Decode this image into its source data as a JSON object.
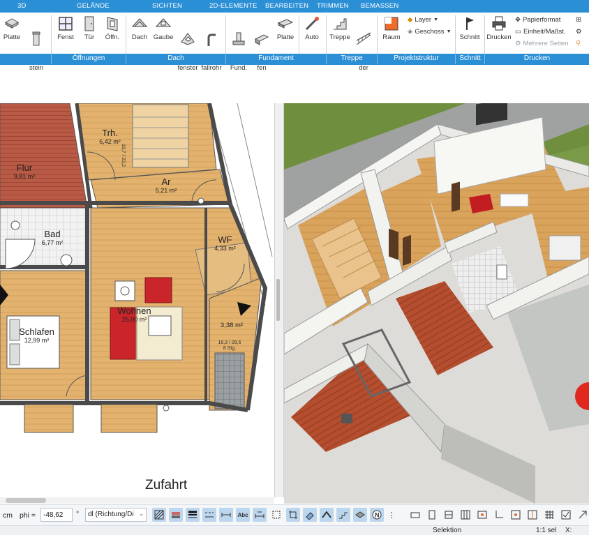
{
  "tabs": [
    "3D",
    "GELÄNDE",
    "SICHTEN",
    "2D-ELEMENTE",
    "BEARBEITEN",
    "TRIMMEN",
    "BEMASSEN"
  ],
  "ribbon": {
    "platte1": "Platte",
    "schornstein": "Schorn-\nstein",
    "fenst": "Fenst",
    "tuer": "Tür",
    "oeffn": "Öffn.",
    "dach": "Dach",
    "gaube": "Gaube",
    "dachfenster": "Dach-\nfenster",
    "regenfallrohr": "Regen-\nfallrohr",
    "einzelfund": "Einzel\nFund.",
    "streifen": "Strei-\nfen",
    "platte2": "Platte",
    "auto": "Auto",
    "treppe": "Treppe",
    "gelaender": "Gelän-\nder",
    "raum": "Raum",
    "layer": "Layer",
    "geschoss": "Geschoss",
    "schnitt": "Schnitt",
    "drucken": "Drucken",
    "papierformat": "Papierformat",
    "einheit": "Einheit/Maßst.",
    "mehrere_seiten": "Mehrere Seiten"
  },
  "groups": [
    "Öffnungen",
    "Dach",
    "Fundament",
    "Treppe",
    "Projektstruktur",
    "Schnitt",
    "Drucken"
  ],
  "plan": {
    "rooms": [
      {
        "name": "Flur",
        "area": "9,81 m²"
      },
      {
        "name": "Trh.",
        "area": "6,42 m²"
      },
      {
        "name": "Ar",
        "area": "5,21 m²"
      },
      {
        "name": "Bad",
        "area": "6,77 m²"
      },
      {
        "name": "WF",
        "area": "4,33 m²"
      },
      {
        "name": "Wohnen",
        "area": "25,00 m²"
      },
      {
        "name": "Schlafen",
        "area": "12,99 m²"
      },
      {
        "name": "",
        "area": "3,38 m²"
      }
    ],
    "stair1": "18,7 / 23,2",
    "stair2": "16,3 / 28,6",
    "stair2b": "8 Stg.",
    "zufahrt": "Zufahrt"
  },
  "bottom": {
    "unit": "cm",
    "phi_label": "phi =",
    "phi_value": "-48,62",
    "deg": "°",
    "dl_value": "dl (Richtung/Di"
  },
  "status": {
    "mode": "Selektion",
    "scale": "1:1 sel",
    "x": "X:"
  }
}
